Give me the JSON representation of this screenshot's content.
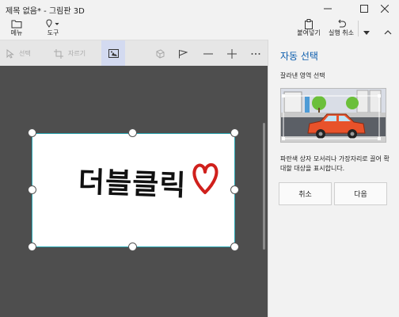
{
  "window": {
    "title": "제목 없음* - 그림판 3D"
  },
  "ribbon": {
    "menu_label": "메뉴",
    "tools_label": "도구",
    "paste_label": "붙여넣기",
    "undo_label": "실행 취소"
  },
  "toolbar": {
    "select_label": "선택",
    "crop_label": "자르기"
  },
  "panel": {
    "title": "자동 선택",
    "subtitle": "잘라낸 영역 선택",
    "description": "파란색 상자 모서리나 가장자리로 끌어 확대할 대상을 표시합니다.",
    "cancel_label": "취소",
    "next_label": "다음"
  },
  "canvas": {
    "drawing_text": "더블클릭",
    "heart_color": "#d0201c"
  },
  "colors": {
    "accent": "#0b5cad",
    "canvas_bg": "#4e4e4e",
    "selection_border": "#2aa7b3",
    "active_tool": "#d3daf0"
  }
}
